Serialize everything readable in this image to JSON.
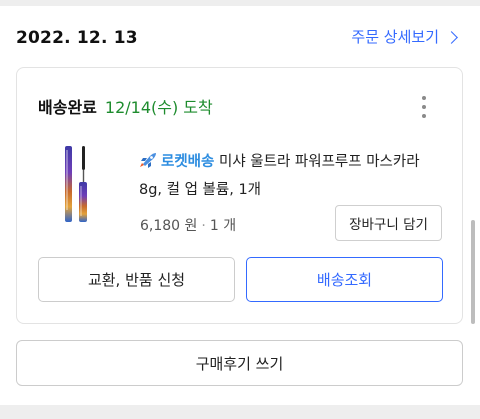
{
  "order": {
    "date": "2022. 12. 13",
    "detail_link": "주문 상세보기"
  },
  "shipment": {
    "status": "배송완료",
    "arrival": "12/14(수) 도착",
    "badge": "로켓배송",
    "product_name": "미샤 울트라 파워프루프 마스카라 8g, 컬 업 볼륨, 1개",
    "price": "6,180 원",
    "quantity": "1 개",
    "cart_button": "장바구니 담기",
    "exchange_button": "교환, 반품 신청",
    "tracking_button": "배송조회",
    "icons": [
      "more-vertical-icon",
      "rocket-icon",
      "chevron-right-icon"
    ]
  },
  "review_button": "구매후기 쓰기",
  "colors": {
    "accent": "#346aff",
    "arrival_green": "#1e8c2e",
    "rocket_blue": "#2d8de0"
  }
}
